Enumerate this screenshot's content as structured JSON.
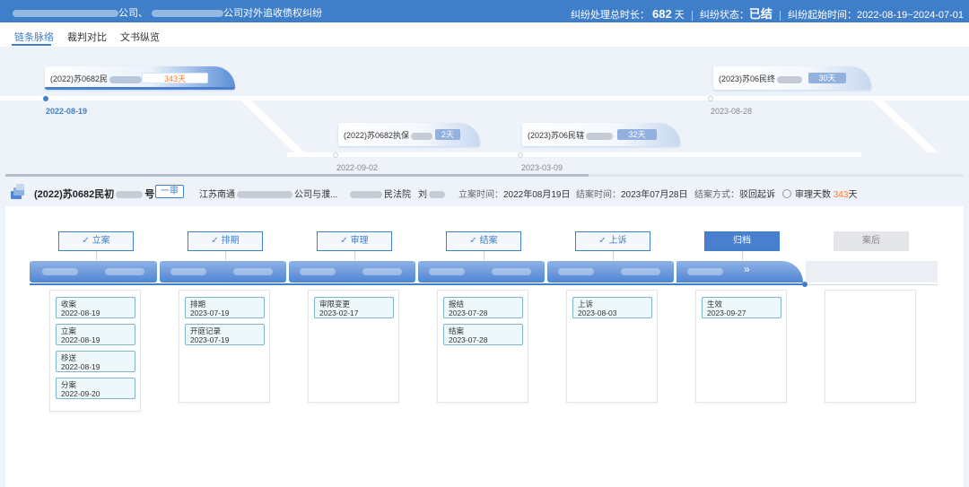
{
  "header": {
    "title_mid": "公司、",
    "title_end": "公司对外追收债权纠纷",
    "duration_label": "纠纷处理总时长：",
    "duration_value": "682",
    "duration_unit": "天",
    "status_label": "纠纷状态：",
    "status_value": "已结",
    "time_label": "纠纷起始时间：",
    "time_value": "2022-08-19~2024-07-01"
  },
  "tabs": [
    "链条脉络",
    "裁判对比",
    "文书纵览"
  ],
  "timeline": {
    "main": {
      "code": "(2022)苏0682民",
      "days": "343天",
      "date": "2022-08-19"
    },
    "enforce": {
      "code": "(2022)苏0682执保",
      "days": "2天",
      "date": "2022-09-02"
    },
    "mid": {
      "code": "(2023)苏06民辖",
      "days": "32天",
      "date": "2023-03-09"
    },
    "right": {
      "code": "(2023)苏06民终",
      "days": "30天",
      "date": "2023-08-28"
    }
  },
  "case": {
    "code": "(2022)苏0682民初",
    "code_end": "号",
    "level": "一审",
    "parties_start": "江苏南通",
    "parties_end": "公司与濮...",
    "court_end": "民法院",
    "judge": "刘",
    "filed_label": "立案时间：",
    "filed_value": "2022年08月19日",
    "closed_label": "结案时间：",
    "closed_value": "2023年07月28日",
    "method_label": "结案方式：",
    "method_value": "驳回起诉",
    "days_label": "审理天数",
    "days_value": "343",
    "days_unit": "天"
  },
  "stages": [
    {
      "label": "立案",
      "done": true
    },
    {
      "label": "排期",
      "done": true
    },
    {
      "label": "审理",
      "done": true
    },
    {
      "label": "结案",
      "done": true
    },
    {
      "label": "上诉",
      "done": true
    },
    {
      "label": "归档",
      "done": false,
      "current": true
    },
    {
      "label": "案后",
      "done": false
    }
  ],
  "events": [
    [
      {
        "name": "收案",
        "date": "2022-08-19"
      },
      {
        "name": "立案",
        "date": "2022-08-19"
      },
      {
        "name": "移送",
        "date": "2022-08-19"
      },
      {
        "name": "分案",
        "date": "2022-09-20"
      }
    ],
    [
      {
        "name": "排期",
        "date": "2023-07-19"
      },
      {
        "name": "开庭记录",
        "date": "2023-07-19"
      }
    ],
    [
      {
        "name": "审限变更",
        "date": "2023-02-17"
      }
    ],
    [
      {
        "name": "报结",
        "date": "2023-07-28"
      },
      {
        "name": "结案",
        "date": "2023-07-28"
      }
    ],
    [
      {
        "name": "上诉",
        "date": "2023-08-03"
      }
    ],
    [
      {
        "name": "生效",
        "date": "2023-09-27"
      }
    ],
    []
  ],
  "icons": {
    "check": "check-icon",
    "chevron": "double-chevron-right-icon",
    "case": "document-stack-icon",
    "clock": "clock-icon"
  },
  "colors": {
    "primary": "#3f7fca",
    "accent": "#ff7a2e",
    "bar": "#4f86d3"
  }
}
